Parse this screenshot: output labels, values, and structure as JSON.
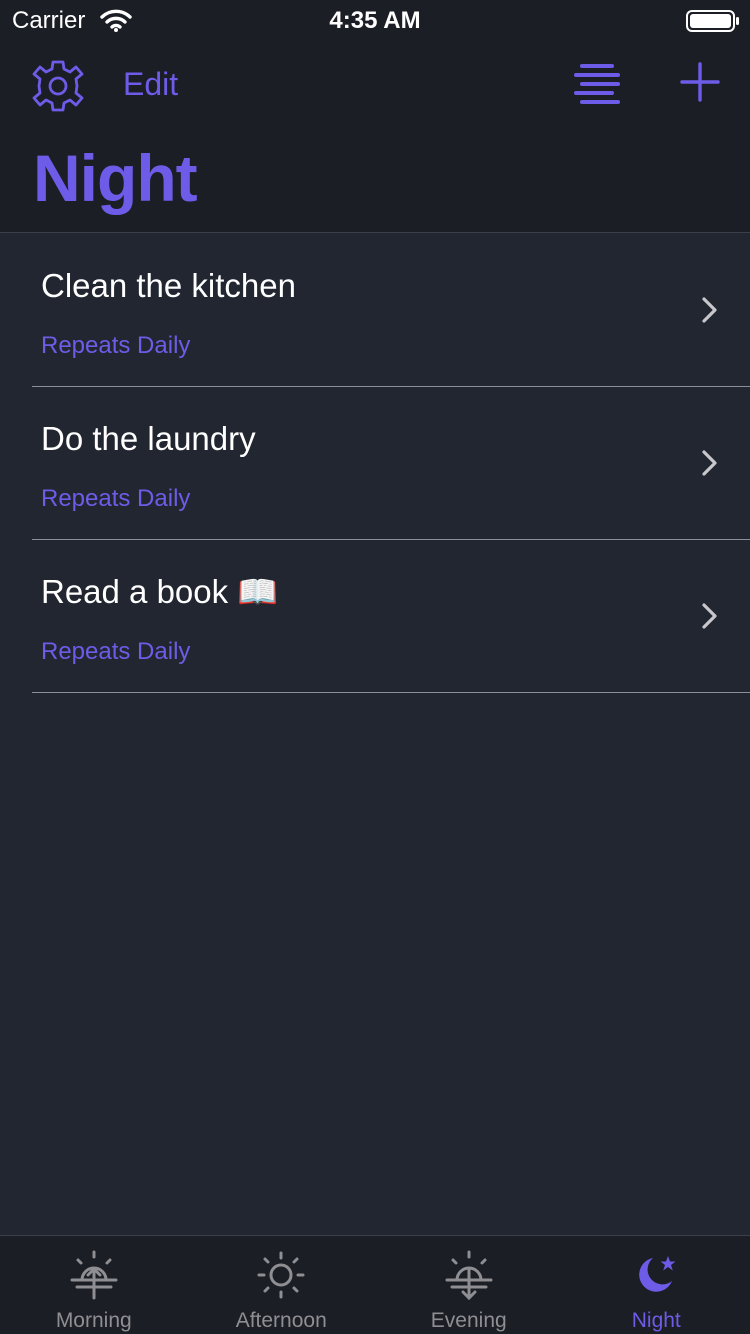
{
  "status_bar": {
    "carrier": "Carrier",
    "time": "4:35 AM",
    "wifi_icon": "wifi-icon",
    "battery_icon": "battery-icon"
  },
  "nav": {
    "settings_icon": "gear-icon",
    "edit_label": "Edit",
    "sort_icon": "sort-lines-icon",
    "add_icon": "plus-icon",
    "title": "Night"
  },
  "tasks": [
    {
      "title": "Clean the kitchen",
      "subtitle": "Repeats Daily"
    },
    {
      "title": "Do the laundry",
      "subtitle": "Repeats Daily"
    },
    {
      "title": "Read a book 📖",
      "subtitle": "Repeats Daily"
    }
  ],
  "tabs": [
    {
      "label": "Morning",
      "icon": "sunrise-icon",
      "active": false
    },
    {
      "label": "Afternoon",
      "icon": "sun-icon",
      "active": false
    },
    {
      "label": "Evening",
      "icon": "sunset-icon",
      "active": false
    },
    {
      "label": "Night",
      "icon": "moon-star-icon",
      "active": true
    }
  ],
  "colors": {
    "accent": "#6d5ce7",
    "background": "#212630",
    "header_background": "#1b1e24",
    "inactive_tab": "#8e8e93"
  }
}
